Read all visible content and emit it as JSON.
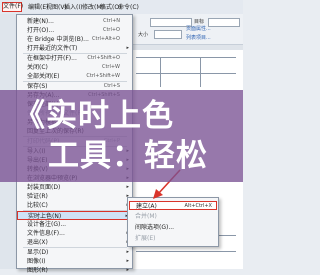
{
  "menubar": {
    "items": [
      "文件(F)",
      "编辑(E)",
      "视图(V)",
      "插入(I)",
      "修改(M)",
      "格式(O)",
      "命令(C)"
    ]
  },
  "toolbar": {
    "label_a": "目标",
    "link_a": "页面属性...",
    "label_b": "大小",
    "link_b": "列表项目..."
  },
  "dropdown": {
    "items": [
      {
        "label": "新建(N)...",
        "shortcut": "Ctrl+N",
        "disabled": false,
        "submenu": false
      },
      {
        "label": "打开(O)...",
        "shortcut": "Ctrl+O",
        "disabled": false,
        "submenu": false
      },
      {
        "label": "在 Bridge 中浏览(B)...",
        "shortcut": "Ctrl+Alt+O",
        "disabled": false,
        "submenu": false
      },
      {
        "label": "打开最近的文件(T)",
        "shortcut": "",
        "disabled": false,
        "submenu": true
      },
      {
        "label": "在框架中打开(F)...",
        "shortcut": "Ctrl+Shift+O",
        "disabled": false,
        "submenu": false
      },
      {
        "label": "关闭(C)",
        "shortcut": "Ctrl+W",
        "disabled": false,
        "submenu": false
      },
      {
        "label": "全部关闭(E)",
        "shortcut": "Ctrl+Shift+W",
        "disabled": false,
        "submenu": false
      },
      {
        "label": "保存(S)",
        "shortcut": "Ctrl+S",
        "disabled": false,
        "submenu": false
      },
      {
        "label": "另存为(A)...",
        "shortcut": "Ctrl+Shift+S",
        "disabled": false,
        "submenu": false
      },
      {
        "label": "保存全部(L)",
        "shortcut": "",
        "disabled": false,
        "submenu": false
      },
      {
        "label": "保存所有相关文件(R)",
        "shortcut": "",
        "disabled": true,
        "submenu": false
      },
      {
        "label": "另存为模板(M)...",
        "shortcut": "",
        "disabled": false,
        "submenu": false
      },
      {
        "label": "回复至上次的保存(R)",
        "shortcut": "",
        "disabled": false,
        "submenu": false
      },
      {
        "label": "打印代码(P)...",
        "shortcut": "Ctrl+P",
        "disabled": true,
        "submenu": false
      },
      {
        "label": "导入(I)",
        "shortcut": "",
        "disabled": false,
        "submenu": true
      },
      {
        "label": "导出(E)",
        "shortcut": "",
        "disabled": false,
        "submenu": true
      },
      {
        "label": "转换(V)",
        "shortcut": "",
        "disabled": false,
        "submenu": true
      },
      {
        "label": "在浏览器中预览(P)",
        "shortcut": "",
        "disabled": false,
        "submenu": true
      },
      {
        "label": "封装页面(D)",
        "shortcut": "",
        "disabled": false,
        "submenu": true
      },
      {
        "label": "验证(R)",
        "shortcut": "",
        "disabled": false,
        "submenu": true
      },
      {
        "label": "比较(C)",
        "shortcut": "",
        "disabled": false,
        "submenu": true
      },
      {
        "label": "实时上色(N)",
        "shortcut": "",
        "disabled": false,
        "submenu": true
      },
      {
        "label": "设计备注(G)...",
        "shortcut": "",
        "disabled": false,
        "submenu": false
      },
      {
        "label": "文件信息(F)...",
        "shortcut": "",
        "disabled": false,
        "submenu": true
      },
      {
        "label": "退出(X)",
        "shortcut": "",
        "disabled": false,
        "submenu": true
      },
      {
        "label": "显示(D)",
        "shortcut": "",
        "disabled": false,
        "submenu": true
      },
      {
        "label": "图像(I)",
        "shortcut": "",
        "disabled": false,
        "submenu": true
      },
      {
        "label": "图形(R)",
        "shortcut": "",
        "disabled": false,
        "submenu": true
      }
    ],
    "highlight_index": 21
  },
  "submenu": {
    "items": [
      {
        "label": "建立(A)",
        "shortcut": "Alt+Ctrl+X",
        "disabled": false
      },
      {
        "label": "合并(M)",
        "shortcut": "",
        "disabled": true
      },
      {
        "label": "间隙选项(G)...",
        "shortcut": "",
        "disabled": false
      },
      {
        "label": "扩展(E)",
        "shortcut": "",
        "disabled": true
      }
    ],
    "highlight_index": 0
  },
  "banner": {
    "line1": "《实时上色",
    "line2": "工具：轻松"
  },
  "colors": {
    "highlight_border": "#d9342b",
    "banner_overlay": "#7a5294"
  }
}
